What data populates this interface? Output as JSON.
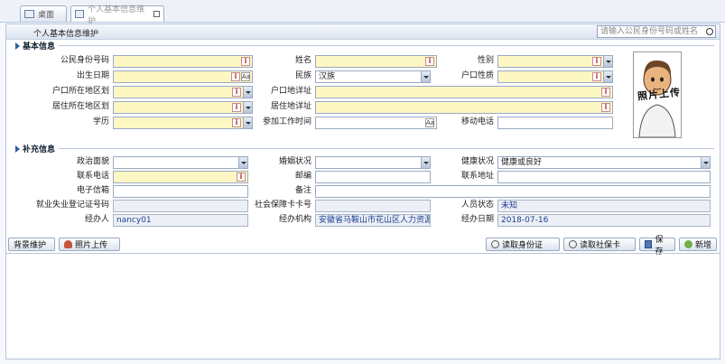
{
  "tabs": [
    {
      "label": "桌面"
    },
    {
      "label": "个人基本信息维护"
    }
  ],
  "panel": {
    "title": "个人基本信息维护",
    "search_placeholder": "请输入公民身份号码或姓名"
  },
  "basic": {
    "title": "基本信息",
    "id_label": "公民身份号码",
    "name_label": "姓名",
    "gender_label": "性别",
    "birth_label": "出生日期",
    "ethnic_label": "民族",
    "ethnic_value": "汉族",
    "hukou_nature_label": "户口性质",
    "hukou_area_label": "户口所在地区划",
    "hukou_addr_label": "户口地详址",
    "res_area_label": "居住所在地区划",
    "res_addr_label": "居住地详址",
    "edu_label": "学历",
    "work_time_label": "参加工作时间",
    "mobile_label": "移动电话",
    "photo_text": "照片上传"
  },
  "extra": {
    "title": "补充信息",
    "political_label": "政治面貌",
    "marital_label": "婚姻状况",
    "health_label": "健康状况",
    "health_value": "健康或良好",
    "phone_label": "联系电话",
    "postcode_label": "邮编",
    "address_label": "联系地址",
    "email_label": "电子信箱",
    "remark_label": "备注",
    "unemp_label": "就业失业登记证号码",
    "social_card_label": "社会保障卡卡号",
    "status_label": "人员状态",
    "status_value": "未知",
    "handler_label": "经办人",
    "handler_value": "nancy01",
    "agency_label": "经办机构",
    "agency_value": "安徽省马鞍山市花山区人力资源",
    "date_label": "经办日期",
    "date_value": "2018-07-16"
  },
  "buttons": {
    "bg": "背景维护",
    "photo": "照片上传",
    "read_id": "读取身份证",
    "read_social": "读取社保卡",
    "save": "保存",
    "new": "新增"
  }
}
